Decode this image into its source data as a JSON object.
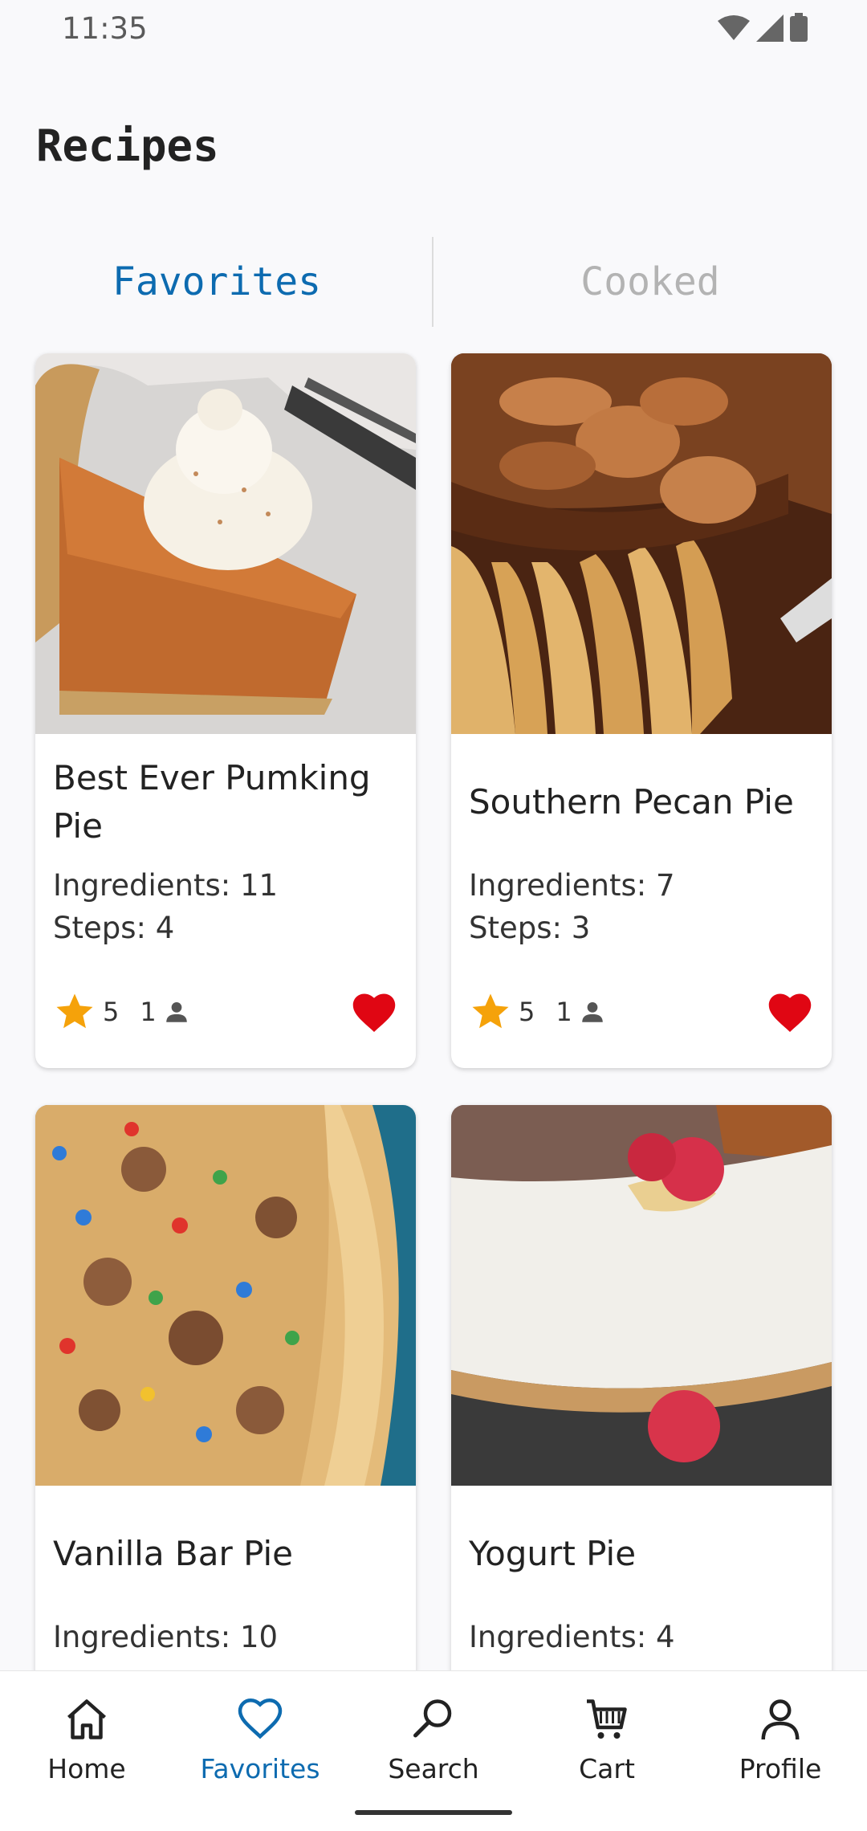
{
  "status": {
    "time": "11:35"
  },
  "header": {
    "title": "Recipes"
  },
  "tabs": [
    {
      "label": "Favorites",
      "active": true
    },
    {
      "label": "Cooked",
      "active": false
    }
  ],
  "recipes": [
    {
      "title": "Best Ever Pumking Pie",
      "ingredients": "Ingredients: 11",
      "steps": "Steps: 4",
      "rating": "5",
      "users": "1",
      "favorite": true,
      "image": "pumpkin-pie"
    },
    {
      "title": "Southern Pecan Pie",
      "ingredients": "Ingredients: 7",
      "steps": "Steps: 3",
      "rating": "5",
      "users": "1",
      "favorite": true,
      "image": "pecan-pie"
    },
    {
      "title": "Vanilla Bar Pie",
      "ingredients": "Ingredients: 10",
      "steps": "",
      "rating": "",
      "users": "",
      "favorite": true,
      "image": "cookie-pie"
    },
    {
      "title": "Yogurt Pie",
      "ingredients": "Ingredients: 4",
      "steps": "",
      "rating": "",
      "users": "",
      "favorite": true,
      "image": "yogurt-pie"
    }
  ],
  "nav": [
    {
      "label": "Home",
      "icon": "home-icon"
    },
    {
      "label": "Favorites",
      "icon": "heart-icon",
      "active": true
    },
    {
      "label": "Search",
      "icon": "search-icon"
    },
    {
      "label": "Cart",
      "icon": "cart-icon"
    },
    {
      "label": "Profile",
      "icon": "profile-icon"
    }
  ],
  "colors": {
    "accent": "#0d6bb0",
    "heart": "#e00613",
    "star": "#f5a20a"
  }
}
